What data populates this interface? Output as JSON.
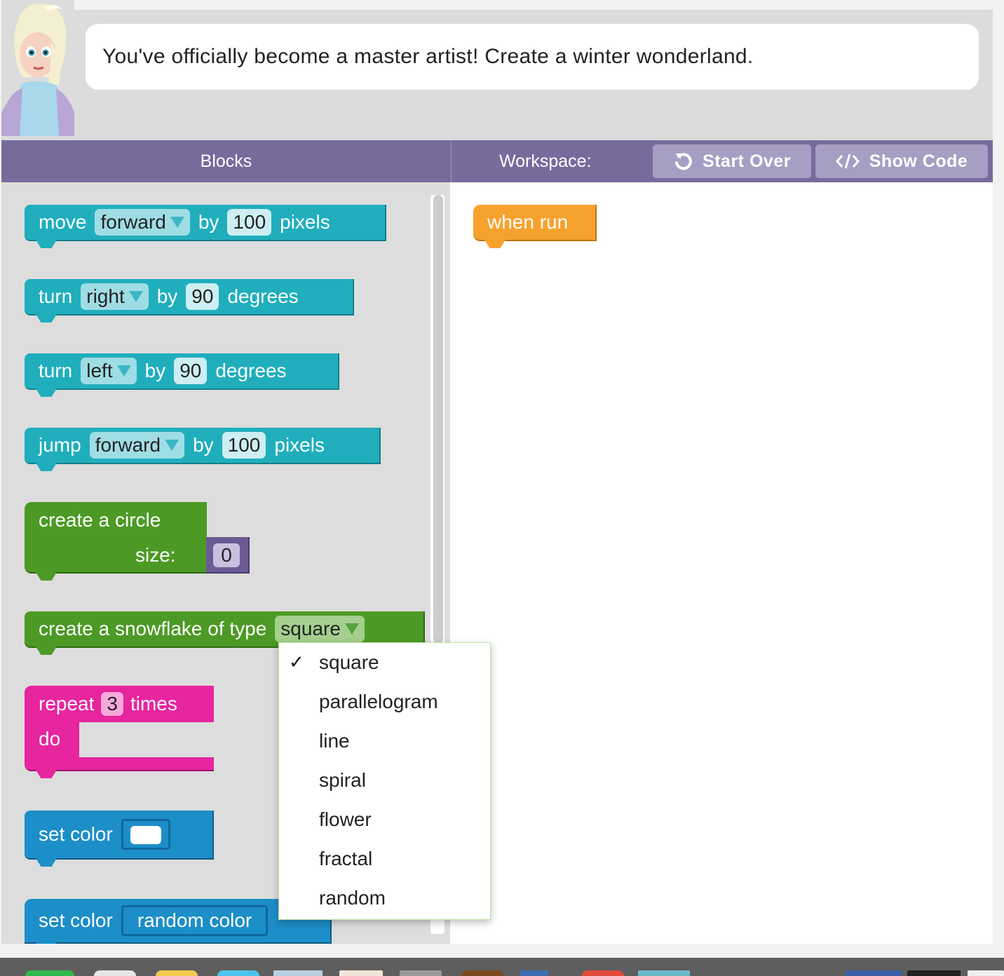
{
  "instruction": {
    "text": "You've officially become a master artist! Create a winter wonderland."
  },
  "header": {
    "blocks_title": "Blocks",
    "workspace_title": "Workspace:",
    "start_over_label": "Start Over",
    "show_code_label": "Show Code"
  },
  "toolbox": {
    "move": {
      "word": "move",
      "dir": "forward",
      "by": "by",
      "amount": "100",
      "unit": "pixels"
    },
    "turn_right": {
      "word": "turn",
      "dir": "right",
      "by": "by",
      "amount": "90",
      "unit": "degrees"
    },
    "turn_left": {
      "word": "turn",
      "dir": "left",
      "by": "by",
      "amount": "90",
      "unit": "degrees"
    },
    "jump": {
      "word": "jump",
      "dir": "forward",
      "by": "by",
      "amount": "100",
      "unit": "pixels"
    },
    "circle": {
      "line1": "create a circle",
      "size_label": "size:",
      "size_value": "0"
    },
    "snowflake": {
      "label": "create a snowflake of type",
      "type": "square"
    },
    "repeat": {
      "label": "repeat",
      "count": "3",
      "times": "times",
      "do": "do"
    },
    "set_color": {
      "label": "set color"
    },
    "set_color_random": {
      "label": "set color",
      "value": "random color"
    }
  },
  "workspace": {
    "when_run": "when run"
  },
  "dropdown": {
    "check": "✓",
    "options": [
      "square",
      "parallelogram",
      "line",
      "spiral",
      "flower",
      "fractal",
      "random"
    ],
    "selected": "square"
  },
  "colors": {
    "header_purple": "#776b9c",
    "button_lavender": "#a79ec3",
    "motion_teal": "#20aebd",
    "shape_green": "#4c9a25",
    "loop_pink": "#e6259e",
    "color_blue": "#1c8ec8",
    "event_orange": "#f7a12d"
  }
}
